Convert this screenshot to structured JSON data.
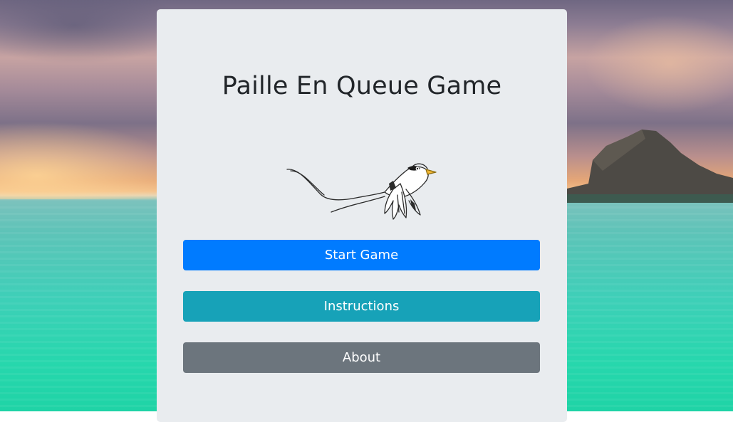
{
  "title": "Paille En Queue Game",
  "buttons": {
    "start": "Start Game",
    "instructions": "Instructions",
    "about": "About"
  },
  "colors": {
    "card": "#e9ecef",
    "start": "#007bff",
    "instructions": "#17a2b8",
    "about": "#6c757d",
    "title": "#212529"
  },
  "icons": [
    "bird-icon"
  ]
}
